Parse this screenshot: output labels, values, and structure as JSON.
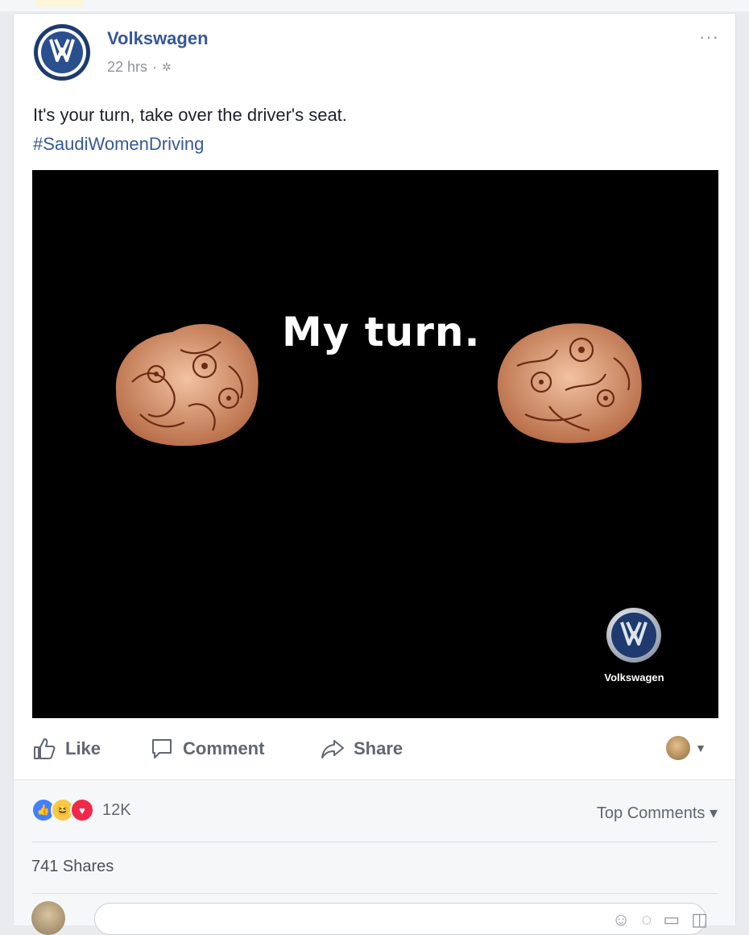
{
  "post": {
    "page_name": "Volkswagen",
    "time": "22 hrs",
    "privacy_icon": "globe-icon",
    "more_label": "···",
    "text": "It's your turn, take over the driver's seat.",
    "hashtag": "#SaudiWomenDriving"
  },
  "media": {
    "headline": "My turn.",
    "brand_label": "Volkswagen"
  },
  "actions": {
    "like": "Like",
    "comment": "Comment",
    "share": "Share"
  },
  "stats": {
    "reaction_icons": [
      "like",
      "haha",
      "love"
    ],
    "reaction_count": "12K",
    "top_comments": "Top Comments ▾",
    "shares": "741 Shares"
  },
  "colors": {
    "link": "#365899",
    "like_blue": "#4080ff",
    "love_red": "#f0284a",
    "haha_yellow": "#f7c94b",
    "vw_blue": "#1e3a6e"
  }
}
